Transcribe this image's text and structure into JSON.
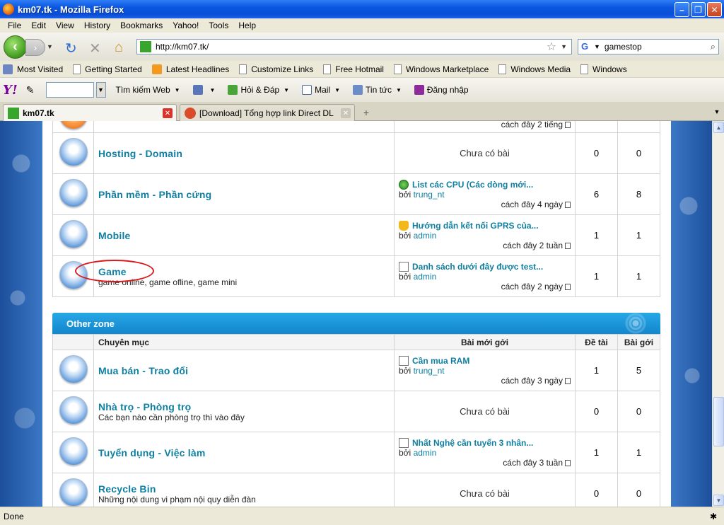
{
  "window": {
    "title": "km07.tk - Mozilla Firefox"
  },
  "menu": [
    "File",
    "Edit",
    "View",
    "History",
    "Bookmarks",
    "Yahoo!",
    "Tools",
    "Help"
  ],
  "nav": {
    "url": "http://km07.tk/",
    "search_value": "gamestop"
  },
  "bookmarks": [
    "Most Visited",
    "Getting Started",
    "Latest Headlines",
    "Customize Links",
    "Free Hotmail",
    "Windows Marketplace",
    "Windows Media",
    "Windows"
  ],
  "yahoo": {
    "search_web": "Tìm kiếm Web",
    "answers": "Hỏi & Đáp",
    "mail": "Mail",
    "news": "Tin tức",
    "login": "Đăng nhập"
  },
  "tabs": [
    {
      "label": "km07.tk"
    },
    {
      "label": "[Download] Tổng hợp link Direct DL ga..."
    }
  ],
  "forum_top": {
    "partial_time": "cách đây 2 tiếng",
    "rows": [
      {
        "name": "Hosting - Domain",
        "desc": "",
        "last_title": "",
        "last_by": "",
        "last_user": "",
        "last_time": "",
        "nopost": "Chưa có bài",
        "topics": "0",
        "posts": "0"
      },
      {
        "name": "Phần mềm - Phần cứng",
        "desc": "",
        "last_title": "List các CPU (Các dòng mới...",
        "last_by": "bởi",
        "last_user": "trung_nt",
        "last_time": "cách đây 4 ngày",
        "nopost": "",
        "topics": "6",
        "posts": "8"
      },
      {
        "name": "Mobile",
        "desc": "",
        "last_title": "Hướng dẫn kết nối GPRS của...",
        "last_by": "bởi",
        "last_user": "admin",
        "last_time": "cách đây 2 tuần",
        "nopost": "",
        "topics": "1",
        "posts": "1"
      },
      {
        "name": "Game",
        "desc": "game online, game ofline, game mini",
        "last_title": "Danh sách dưới đây được test...",
        "last_by": "bởi",
        "last_user": "admin",
        "last_time": "cách đây 2 ngày",
        "nopost": "",
        "topics": "1",
        "posts": "1"
      }
    ]
  },
  "other_zone": {
    "title": "Other zone",
    "headers": {
      "category": "Chuyên mục",
      "latest": "Bài mới gởi",
      "topics": "Đề tài",
      "posts": "Bài gởi"
    },
    "rows": [
      {
        "name": "Mua bán - Trao đổi",
        "desc": "",
        "last_title": "Cần mua RAM",
        "last_by": "bởi",
        "last_user": "trung_nt",
        "last_time": "cách đây 3 ngày",
        "nopost": "",
        "topics": "1",
        "posts": "5"
      },
      {
        "name": "Nhà trọ - Phòng trọ",
        "desc": "Các bạn nào cần phòng trọ thì vào đây",
        "last_title": "",
        "last_by": "",
        "last_user": "",
        "last_time": "",
        "nopost": "Chưa có bài",
        "topics": "0",
        "posts": "0"
      },
      {
        "name": "Tuyển dụng - Việc làm",
        "desc": "",
        "last_title": "Nhất Nghệ cần tuyển 3 nhân...",
        "last_by": "bởi",
        "last_user": "admin",
        "last_time": "cách đây 3 tuần",
        "nopost": "",
        "topics": "1",
        "posts": "1"
      },
      {
        "name": "Recycle Bin",
        "desc": "Những nội dung vi phạm nội quy diễn đàn",
        "last_title": "",
        "last_by": "",
        "last_user": "",
        "last_time": "",
        "nopost": "Chưa có bài",
        "topics": "0",
        "posts": "0"
      }
    ]
  },
  "status": {
    "text": "Done"
  },
  "colors": {
    "link": "#0f7fa1",
    "zone_header": "#1e97dc",
    "annotation": "#d8191d"
  }
}
